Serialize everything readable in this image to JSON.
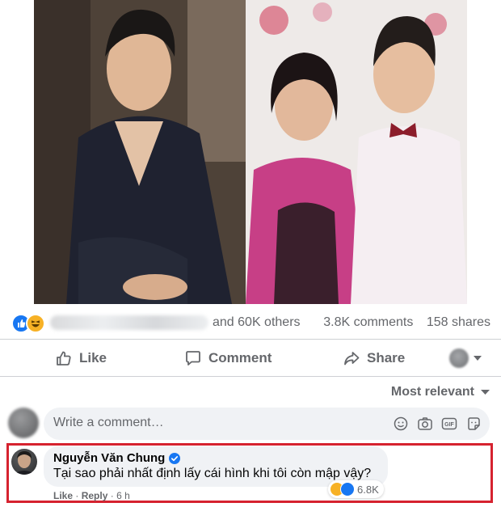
{
  "post": {
    "others_text": "and 60K others",
    "comments_count": "3.8K comments",
    "shares_count": "158 shares",
    "reactions": [
      "like-icon",
      "haha-icon"
    ]
  },
  "actions": {
    "like_label": "Like",
    "comment_label": "Comment",
    "share_label": "Share"
  },
  "sort": {
    "label": "Most relevant"
  },
  "composer": {
    "placeholder": "Write a comment…",
    "icons": [
      "emoji-icon",
      "camera-icon",
      "gif-icon",
      "sticker-icon"
    ]
  },
  "comment": {
    "author": "Nguyễn Văn Chung",
    "text": "Tại sao phải nhất định lấy cái hình khi tôi còn mập vậy?",
    "reaction_count": "6.8K",
    "like_label": "Like",
    "separator": "·",
    "reply_label": "Reply",
    "time": "6 h"
  },
  "colors": {
    "facebook_blue": "#1877f2",
    "secondary_text": "#65676b",
    "highlight_border": "#d6222f",
    "comment_bubble": "#f0f2f5"
  }
}
